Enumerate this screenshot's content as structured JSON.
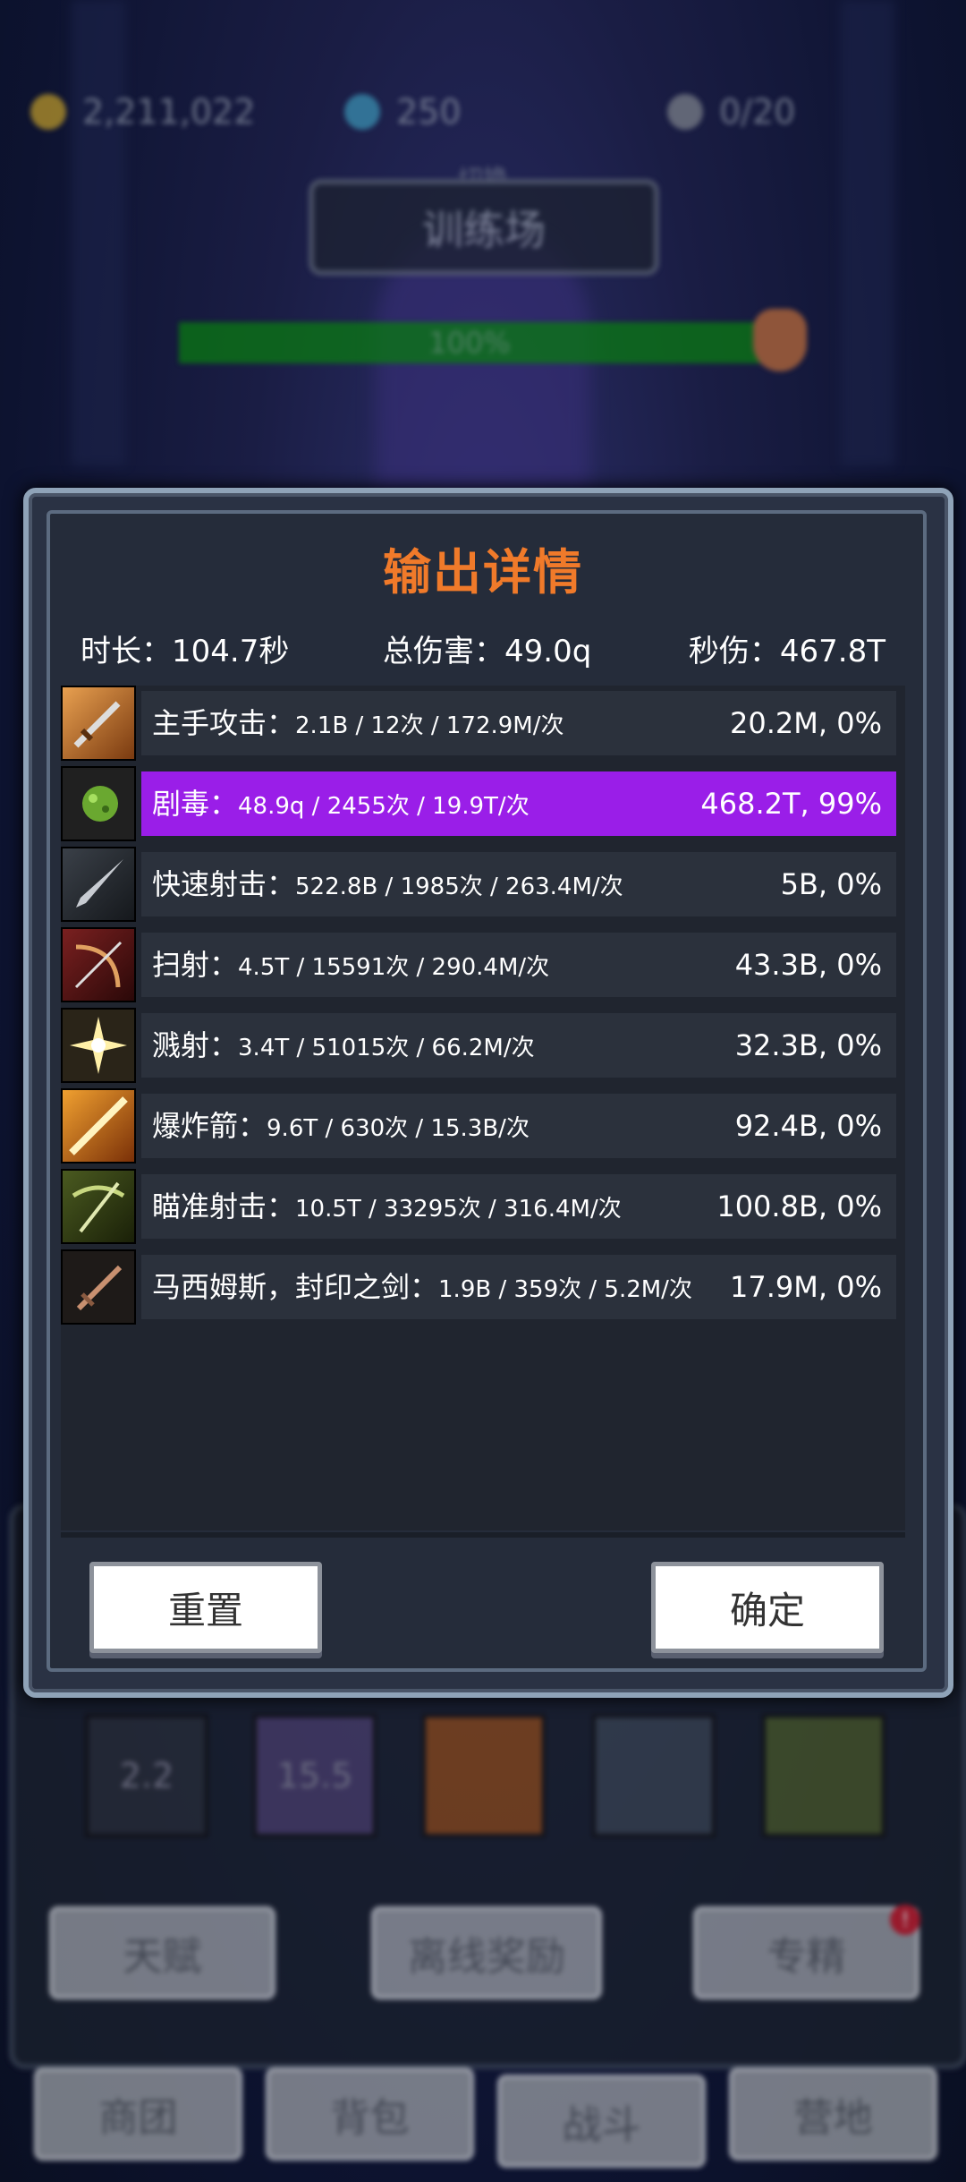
{
  "resources": {
    "gold": "2,211,022",
    "gems": "250",
    "keys": "0/20"
  },
  "stage": {
    "switch_label": "切换",
    "button": "训练场",
    "progress_percent": 100,
    "progress_text": "100%"
  },
  "modal": {
    "title": "输出详情",
    "duration": "时长：104.7秒",
    "total_damage": "总伤害：49.0q",
    "dps": "秒伤：467.8T",
    "rows": [
      {
        "label": "主手攻击：",
        "detail": "2.1B  /  12次  /  172.9M/次",
        "value": "20.2M, 0%",
        "icon": "sword-icon"
      },
      {
        "label": "剧毒：",
        "detail": "48.9q  /  2455次  /  19.9T/次",
        "value": "468.2T, 99%",
        "icon": "poison-icon"
      },
      {
        "label": "快速射击：",
        "detail": "522.8B  /  1985次  /  263.4M/次",
        "value": "5B, 0%",
        "icon": "arrow-icon"
      },
      {
        "label": "扫射：",
        "detail": "4.5T  /  15591次  /  290.4M/次",
        "value": "43.3B, 0%",
        "icon": "bow-icon"
      },
      {
        "label": "溅射：",
        "detail": "3.4T  /  51015次  /  66.2M/次",
        "value": "32.3B, 0%",
        "icon": "burst-icon"
      },
      {
        "label": "爆炸箭：",
        "detail": "9.6T  /  630次  /  15.3B/次",
        "value": "92.4B, 0%",
        "icon": "explosive-arrow-icon"
      },
      {
        "label": "瞄准射击：",
        "detail": "10.5T  /  33295次  /  316.4M/次",
        "value": "100.8B, 0%",
        "icon": "crossbow-icon"
      },
      {
        "label": "马西姆斯，封印之剑：",
        "detail": "1.9B  /  359次  /  5.2M/次",
        "value": "17.9M, 0%",
        "icon": "sealed-sword-icon"
      }
    ],
    "reset_label": "重置",
    "confirm_label": "确定"
  },
  "skill_slots": [
    "2.2",
    "15.5",
    "",
    "",
    ""
  ],
  "menu_buttons": {
    "talent": "天赋",
    "offline_reward": "离线奖励",
    "specialize": "专精"
  },
  "nav": {
    "caravan": "商团",
    "backpack": "背包",
    "battle": "战斗",
    "camp": "营地"
  },
  "badge": "!"
}
